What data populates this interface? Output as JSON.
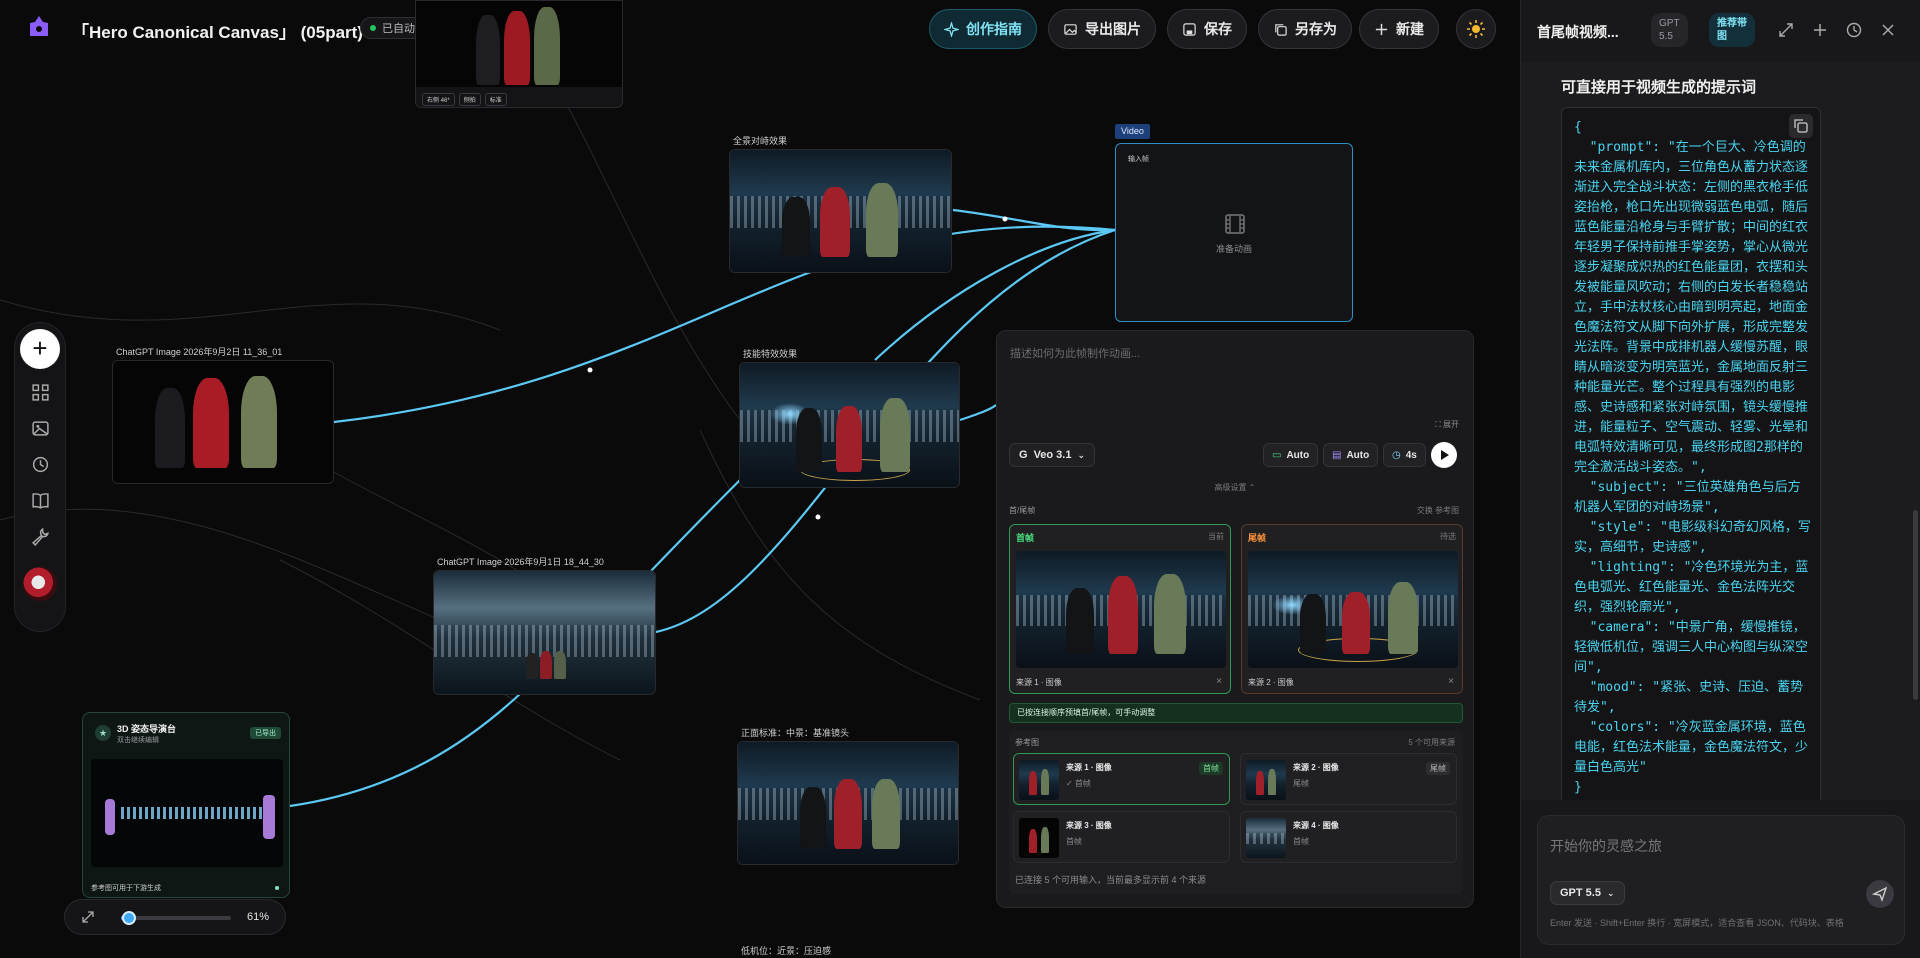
{
  "header": {
    "title": "「Hero Canonical Canvas」 (05part)",
    "autosave": "已自动保存",
    "buttons": {
      "guide": "创作指南",
      "export": "导出图片",
      "save": "保存",
      "save_as": "另存为",
      "new": "新建"
    }
  },
  "nodes": {
    "top_tags": [
      "右侧 46*",
      "侧拍",
      "标准"
    ],
    "panorama": "全景对峙效果",
    "skill": "技能特效效果",
    "chatgpt1": "ChatGPT Image 2026年9月2日 11_36_01",
    "chatgpt2": "ChatGPT Image 2026年9月1日 18_44_30",
    "front": "正面标准：中景：基准镜头",
    "lowangle": "低机位：近景：压迫感",
    "video": {
      "tag": "Video",
      "input": "输入帧",
      "status": "准备动画"
    },
    "director": {
      "title": "3D 姿态导演台",
      "subtitle": "双击继续编辑",
      "badge": "已导出",
      "footer": "参考图可用于下游生成"
    }
  },
  "panel": {
    "placeholder": "描述如何为此帧制作动画...",
    "expand": "展开",
    "model": "Veo 3.1",
    "chips": [
      "Auto",
      "Auto",
      "4s"
    ],
    "advanced": "高级设置",
    "section": "首/尾帧",
    "section_right": "交换  参考图",
    "first": {
      "title": "首帧",
      "right": "当前",
      "source": "来源 1 · 图像"
    },
    "last": {
      "title": "尾帧",
      "right": "待选",
      "source": "来源 2 · 图像"
    },
    "note": "已按连接顺序预填首/尾帧，可手动调整",
    "refs_title": "参考图",
    "refs_count": "5 个可用来源",
    "refs": [
      {
        "title": "来源 1 · 图像",
        "sub": "✓ 首帧",
        "badge": "首帧"
      },
      {
        "title": "来源 2 · 图像",
        "sub": "尾帧",
        "badge": "尾帧"
      },
      {
        "title": "来源 3 · 图像",
        "sub": "首帧",
        "badge": ""
      },
      {
        "title": "来源 4 · 图像",
        "sub": "首帧",
        "badge": ""
      }
    ],
    "footer": "已连接 5 个可用输入，当前最多显示前 4 个来源"
  },
  "zoom": {
    "value": "61%",
    "fraction": 0.61
  },
  "sidebar": {
    "title": "首尾帧视频...",
    "model_chip": "GPT\n5.5",
    "recommend_chip": "推荐带\n图",
    "heading": "可直接用于视频生成的提示词",
    "code": "{\n  \"prompt\": \"在一个巨大、冷色调的未来金属机库内，三位角色从蓄力状态逐渐进入完全战斗状态：左侧的黑衣枪手低姿抬枪，枪口先出现微弱蓝色电弧，随后蓝色能量沿枪身与手臂扩散；中间的红衣年轻男子保持前推手掌姿势，掌心从微光逐步凝聚成炽热的红色能量团，衣摆和头发被能量风吹动；右侧的白发长者稳稳站立，手中法杖核心由暗到明亮起，地面金色魔法符文从脚下向外扩展，形成完整发光法阵。背景中成排机器人缓慢苏醒，眼睛从暗淡变为明亮蓝光，金属地面反射三种能量光芒。整个过程具有强烈的电影感、史诗感和紧张对峙氛围，镜头缓慢推进，能量粒子、空气震动、轻雾、光晕和电弧特效清晰可见，最终形成图2那样的完全激活战斗姿态。\",\n  \"subject\": \"三位英雄角色与后方机器人军团的对峙场景\",\n  \"style\": \"电影级科幻奇幻风格，写实，高细节，史诗感\",\n  \"lighting\": \"冷色环境光为主，蓝色电弧光、红色能量光、金色法阵光交织，强烈轮廓光\",\n  \"camera\": \"中景广角，缓慢推镜，轻微低机位，强调三人中心构图与纵深空间\",\n  \"mood\": \"紧张、史诗、压迫、蓄势待发\",\n  \"colors\": \"冷灰蓝金属环境，蓝色电能，红色法术能量，金色魔法符文，少量白色高光\"\n}",
    "input_placeholder": "开始你的灵感之旅",
    "input_model": "GPT 5.5",
    "hint": "Enter 发送 · Shift+Enter 换行 · 宽屏模式，适合查看 JSON、代码块、表格"
  }
}
